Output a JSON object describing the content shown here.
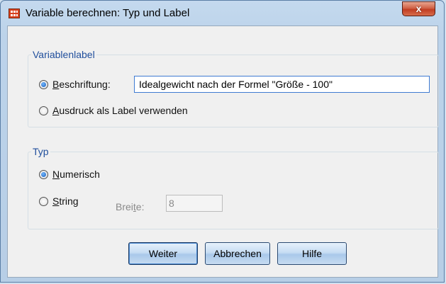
{
  "window": {
    "title": "Variable berechnen: Typ und Label",
    "close_glyph": "x"
  },
  "variablenlabel": {
    "legend": "Variablenlabel",
    "beschriftung_label": "eschriftung:",
    "beschriftung_mnemonic": "B",
    "beschriftung_value": "Idealgewicht nach der Formel \"Größe - 100\"",
    "ausdruck_label": "usdruck als Label verwenden",
    "ausdruck_mnemonic": "A",
    "selected": "beschriftung"
  },
  "typ": {
    "legend": "Typ",
    "numerisch_mnemonic": "N",
    "numerisch_label": "umerisch",
    "string_mnemonic": "S",
    "string_label": "tring",
    "breite_label_pre": "Brei",
    "breite_mnemonic": "t",
    "breite_label_post": "e:",
    "breite_value": "8",
    "selected": "numerisch"
  },
  "buttons": {
    "weiter": "Weiter",
    "abbrechen": "Abbrechen",
    "hilfe": "Hilfe"
  }
}
